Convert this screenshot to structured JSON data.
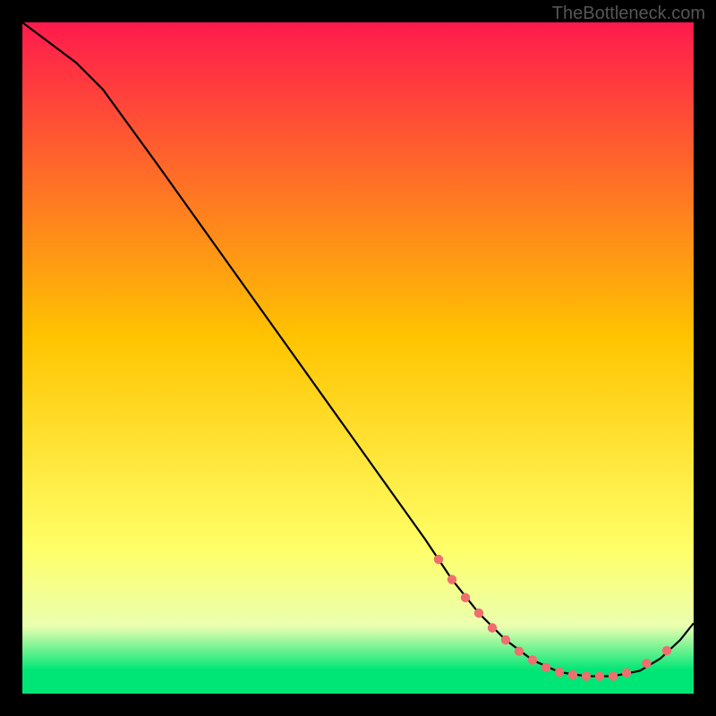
{
  "watermark": "TheBottleneck.com",
  "chart_data": {
    "type": "line",
    "title": "",
    "xlabel": "",
    "ylabel": "",
    "xlim": [
      0,
      100
    ],
    "ylim": [
      0,
      100
    ],
    "background_gradient": {
      "stops": [
        {
          "offset": 0.0,
          "color": "#ff1a4d"
        },
        {
          "offset": 0.47,
          "color": "#ffc400"
        },
        {
          "offset": 0.78,
          "color": "#ffff66"
        },
        {
          "offset": 0.9,
          "color": "#eaffb0"
        },
        {
          "offset": 0.965,
          "color": "#00e676"
        },
        {
          "offset": 1.0,
          "color": "#00e676"
        }
      ]
    },
    "series": [
      {
        "name": "bottleneck-curve",
        "color": "#000000",
        "x": [
          0,
          4,
          8,
          12,
          20,
          30,
          40,
          50,
          60,
          64,
          68,
          72,
          76,
          80,
          84,
          88,
          92,
          95,
          98,
          100
        ],
        "y": [
          100,
          97,
          94,
          90,
          79,
          65,
          51,
          37,
          23,
          17,
          12,
          8,
          5,
          3.2,
          2.6,
          2.6,
          3.4,
          5.2,
          8.0,
          10.5
        ]
      }
    ],
    "markers": {
      "name": "highlight-points",
      "color": "#ef6e6e",
      "x": [
        62,
        64,
        66,
        68,
        70,
        72,
        74,
        76,
        78,
        80,
        82,
        84,
        86,
        88,
        90,
        93,
        96
      ],
      "y": [
        20,
        17,
        14.3,
        12,
        9.8,
        8,
        6.3,
        5,
        3.9,
        3.2,
        2.8,
        2.6,
        2.6,
        2.6,
        3.1,
        4.5,
        6.4
      ]
    }
  }
}
